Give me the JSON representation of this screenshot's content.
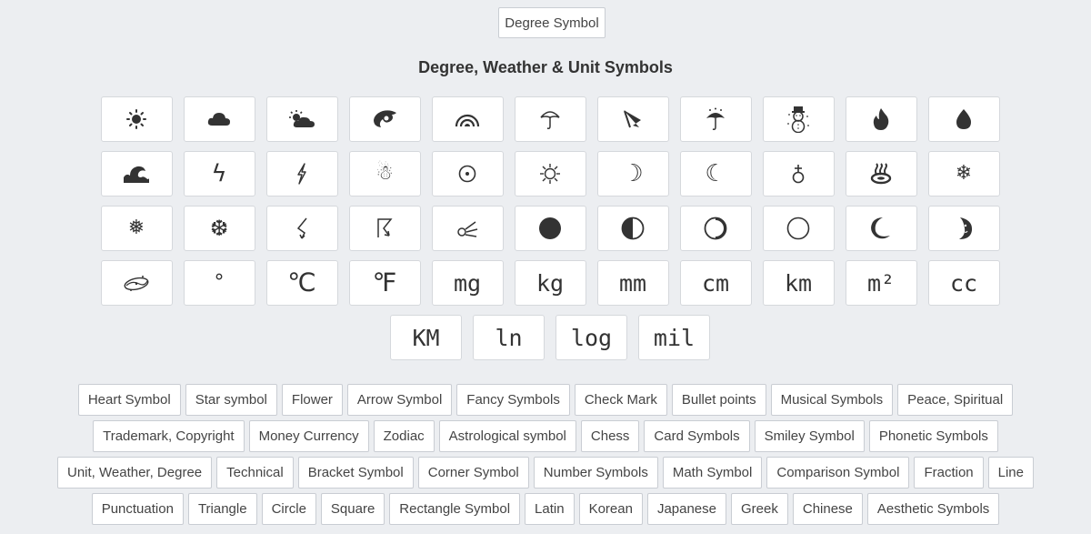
{
  "top_button": "Degree Symbol",
  "title": "Degree, Weather & Unit Symbols",
  "symbols": [
    [
      "☀",
      "☁",
      "⛅",
      "🌀",
      "🌈",
      "☂",
      "☔",
      "☔",
      "⛄",
      "🔥",
      "💧"
    ],
    [
      "🌊",
      "ϟ",
      "⚡",
      "☃",
      "⊙",
      "☼",
      "☽",
      "☾",
      "♁",
      "♨",
      "❄"
    ],
    [
      "❅",
      "❆",
      "☇",
      "☈",
      "☄",
      "●",
      "◐",
      "◑",
      "○",
      "☽",
      "🌛"
    ],
    [
      "🌌",
      "°",
      "℃",
      "℉",
      "㎎",
      "㎏",
      "㎜",
      "㎝",
      "㎞",
      "㎡",
      "㏄"
    ],
    [
      "㎞",
      "㏑",
      "㏒",
      "㏕"
    ]
  ],
  "tags": [
    [
      "Heart Symbol",
      "Star symbol",
      "Flower",
      "Arrow Symbol",
      "Fancy Symbols",
      "Check Mark",
      "Bullet points",
      "Musical Symbols",
      "Peace, Spiritual"
    ],
    [
      "Trademark, Copyright",
      "Money Currency",
      "Zodiac",
      "Astrological symbol",
      "Chess",
      "Card Symbols",
      "Smiley Symbol",
      "Phonetic Symbols"
    ],
    [
      "Unit, Weather, Degree",
      "Technical",
      "Bracket Symbol",
      "Corner Symbol",
      "Number Symbols",
      "Math Symbol",
      "Comparison Symbol",
      "Fraction",
      "Line"
    ],
    [
      "Punctuation",
      "Triangle",
      "Circle",
      "Square",
      "Rectangle Symbol",
      "Latin",
      "Korean",
      "Japanese",
      "Greek",
      "Chinese",
      "Aesthetic Symbols"
    ]
  ],
  "unit_labels": {
    "mg": "mg",
    "kg": "kg",
    "mm": "mm",
    "cm": "cm",
    "km": "km",
    "m2": "m²",
    "cc": "cc",
    "KM": "KM",
    "ln": "ln",
    "log": "log",
    "mil": "mil",
    "degree": "°",
    "celsius": "℃",
    "fahrenheit": "℉"
  }
}
